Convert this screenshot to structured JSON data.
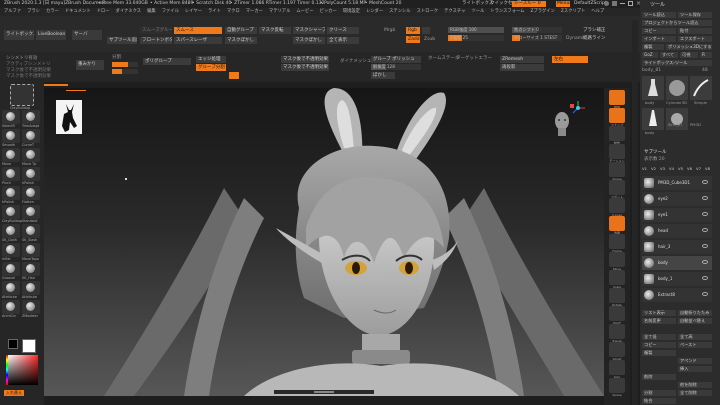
{
  "title_bar": {
    "app_title": "ZBrush 2020.1.3 [日 mayu]ZBrush Document",
    "free_mem": "• Free Mem 33.040GB",
    "active_mem": "• Active Mem 8489",
    "scratch_disk": "• Scratch Disk 40",
    "ztimer": "• ZTimer 1.086 RTimer 1.197 Timer 0.132",
    "polycount": "• PolyCount 5.18 MP",
    "meshcount": "• MeshCount 20",
    "right_menu": "ライトボックス",
    "quick_save": "クイックセーブ",
    "see_through": "シースルー 0",
    "menus_btn": "Menus",
    "script_label": "DefaultZScript"
  },
  "menu_bar": {
    "items": [
      "アルファ",
      "ブラシ",
      "カラー",
      "ドキュメント",
      "ドロー",
      "ダイナミクス",
      "編集",
      "ファイル",
      "レイヤー",
      "ライト",
      "マクロ",
      "マーカー",
      "マテリアル",
      "ムービー",
      "ピッカー",
      "環境設定",
      "レンダー",
      "ステンシル",
      "ストローク",
      "テクスチャ",
      "ツール",
      "トランスフォーム",
      "Zプラグイン",
      "Zスクリプト",
      "ヘルプ"
    ]
  },
  "top_shelf": {
    "lightbox": "ライトボックス",
    "liveboolean": "LiveBoolean",
    "subtool_fx": "サーバ",
    "shelf_buttons": [
      "スムーズグループ",
      "スムース",
      "自動グループ",
      "マスク反転",
      "マスクシャープ",
      "クリース",
      "サブツール追加",
      "フロートンボタン",
      "スパースレーザ",
      "マスクぼかし",
      "マスクぼかし",
      "全て表示"
    ],
    "draw_btn": "Draw",
    "move_btn": "Move",
    "rgb_label": "Rgb",
    "zadd_label": "Zadd",
    "zsub_label": "Zsub",
    "mrgb_label": "Mrgb",
    "z_intensity": "Z強度 25",
    "focal_shift": "焦点シフト 0",
    "rgb_intensity": "RGB強度 100",
    "draw_size": "ドローサイズ 1 STEST",
    "dynamic": "Dynamic",
    "brush_tip": "ブラシ補正",
    "lazy": "経路ライン"
  },
  "second_shelf": {
    "symmetry": "シンメトリ有効",
    "active_symmetry": "アクティブシンメトリ",
    "poly_frame": "重みかり",
    "divide": "分割",
    "subdiv": "最大 ",
    "subdiv_lower": "最大 ",
    "polygroups": "ポリグループ",
    "group_split": "グループ分割",
    "edge_loop": "エッジ処理",
    "mask_by_cavity": "マスク後で不透明効果",
    "mask_blur": "マスク後で不透明効果",
    "dynamesh": "ダイナメッシュ",
    "groups_polish": "グルーブ ポリッシュ",
    "resolution": "解像度 128",
    "home": "ホームステージ",
    "target": "ターゲットエラー",
    "zremesh": "ZRemesh",
    "mirror": "左右",
    "reproject": "再投影",
    "blur": "ぼかし"
  },
  "left_panel": {
    "brushes": [
      {
        "name": "ClayBuildup"
      },
      {
        "name": "SelectR"
      },
      {
        "name": "TrimAdapt"
      },
      {
        "name": "Smooth"
      },
      {
        "name": "CurveT"
      },
      {
        "name": "Move"
      },
      {
        "name": "Move Tp"
      },
      {
        "name": "Pinch"
      },
      {
        "name": "hPolish"
      },
      {
        "name": "hPolish"
      },
      {
        "name": "Flatten"
      },
      {
        "name": "ClayBuildup"
      },
      {
        "name": "Standard"
      },
      {
        "name": "SK_Cloth"
      },
      {
        "name": "SK_Slash"
      },
      {
        "name": "Inflat"
      },
      {
        "name": "MoveTopo"
      },
      {
        "name": "Groovel"
      },
      {
        "name": "SK_Hair"
      },
      {
        "name": "Attribute"
      },
      {
        "name": "Attribute"
      },
      {
        "name": "ArchiCrc"
      },
      {
        "name": "ZModeler"
      }
    ],
    "alpha_label": "Alpha Off",
    "stroke_label": "Dots",
    "color_swatch": "#ffffff",
    "secondary_swatch": "#000000",
    "gradient_btn": "入れ替え"
  },
  "viewport": {
    "doc_title": "ZBrush Document",
    "axis_x": "X",
    "axis_y": "Y",
    "axis_z": "Z"
  },
  "right_tools": {
    "items": [
      "BPR",
      "スナップ",
      "動作",
      "モーション",
      "Xpose",
      "スポット",
      "X-pose",
      "透明",
      "Frame",
      "Move",
      "Scale",
      "Rotate",
      "PolyF",
      "Transp",
      "Ghost",
      "Solo",
      "Xpose"
    ]
  },
  "tool_panel": {
    "header": "ツール",
    "row1": [
      "ツール読込",
      "ツール保存"
    ],
    "row2": [
      "プロジェクトからツール読込",
      "コピー",
      "貼付"
    ],
    "row3": [
      "インポート",
      "エクスポート"
    ],
    "row4": [
      "複製",
      "ポリメッシュ3Dにする"
    ],
    "row5": [
      "GoZ",
      "すべて",
      "可視",
      "R"
    ],
    "lightbox_tools": "ライトボックス›ツール",
    "current_tool": "body_81",
    "tool_count": "48",
    "thumbs": [
      "body",
      "Cylinder3D",
      "Simple",
      "body",
      "Skin_ZI",
      "PM3D"
    ],
    "subtool_header": "サブツール",
    "visible_count": "表示数 20",
    "v_buttons": [
      "V1",
      "V2",
      "V3",
      "V4",
      "V5",
      "V6",
      "V7",
      "V8"
    ],
    "subtools": [
      "PM3D_Cube3D1",
      "eye2",
      "eye1",
      "head",
      "hair_3",
      "body",
      "body_1",
      "Extract8"
    ],
    "list_all": "リスト表示",
    "auto_collapse": "自動折りたたみ",
    "rename": "名前変更",
    "auto_reorder": "自動並べ替え",
    "all_low": "全て低",
    "all_high": "全て高",
    "copy": "コピー",
    "paste": "ペースト",
    "duplicate": "複製",
    "append": "アペンド",
    "insert": "挿入",
    "delete": "削除",
    "del_other": "他を削除",
    "del_all": "全て削除",
    "split": "分割",
    "merge": "結合"
  },
  "colors": {
    "accent_orange": "#f07a1a",
    "panel_bg": "#2a2a2a",
    "viewport_bg_top": "#1b1b1b",
    "viewport_bg_bottom": "#4a4a4a"
  }
}
